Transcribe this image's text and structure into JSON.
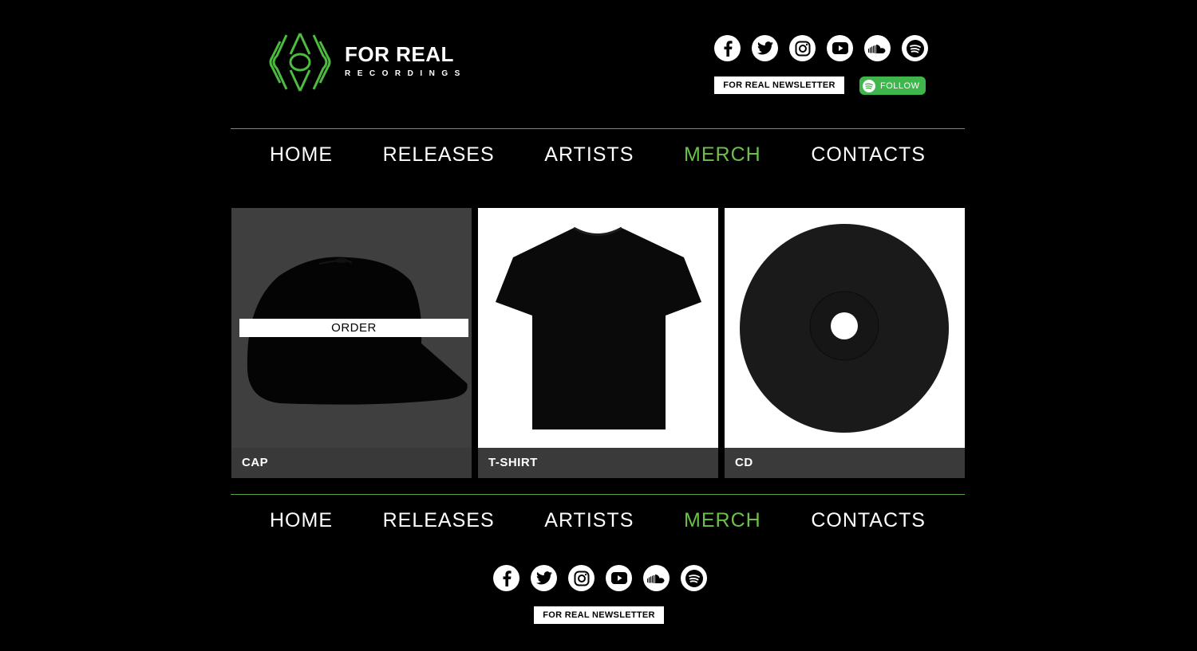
{
  "brand": {
    "name": "FOR REAL",
    "tagline": "RECORDINGS",
    "accent": "#6cc04a"
  },
  "socials": [
    "facebook-icon",
    "twitter-icon",
    "instagram-icon",
    "youtube-icon",
    "soundcloud-icon",
    "spotify-icon"
  ],
  "header": {
    "newsletter": "FOR REAL NEWSLETTER",
    "follow": "FOLLOW"
  },
  "nav": {
    "items": [
      "HOME",
      "RELEASES",
      "ARTISTS",
      "MERCH",
      "CONTACTS"
    ],
    "active": "MERCH"
  },
  "products": [
    {
      "name": "CAP",
      "action": "ORDER"
    },
    {
      "name": "T-SHIRT"
    },
    {
      "name": "CD"
    }
  ],
  "footer": {
    "newsletter": "FOR REAL NEWSLETTER"
  }
}
